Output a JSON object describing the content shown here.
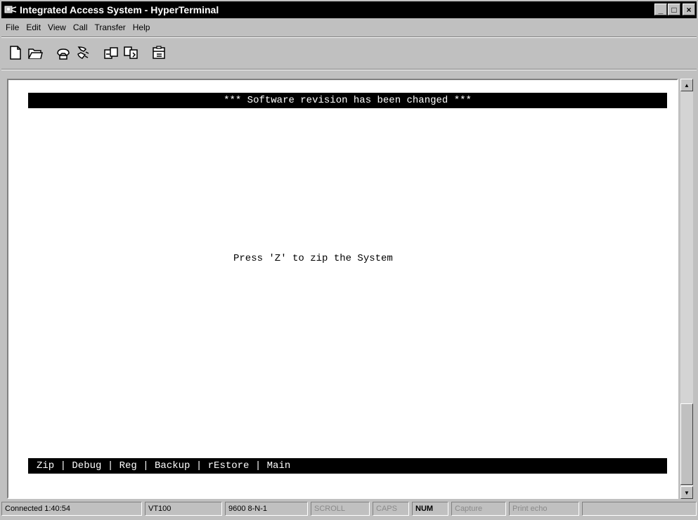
{
  "window": {
    "title": "Integrated Access System - HyperTerminal",
    "controls": {
      "minimize": "_",
      "maximize": "□",
      "close": "×"
    }
  },
  "menu": [
    "File",
    "Edit",
    "View",
    "Call",
    "Transfer",
    "Help"
  ],
  "toolbar": {
    "buttons": [
      "new-icon",
      "open-icon",
      "connect-icon",
      "disconnect-icon",
      "send-icon",
      "receive-icon",
      "properties-icon"
    ]
  },
  "terminal": {
    "header": "*** Software revision has been changed ***",
    "message": "Press 'Z' to zip the System",
    "footer": "Zip | Debug | Reg | Backup | rEstore | Main"
  },
  "statusbar": {
    "connected": "Connected 1:40:54",
    "emulation": "VT100",
    "settings": "9600 8-N-1",
    "scroll": "SCROLL",
    "caps": "CAPS",
    "num": "NUM",
    "capture": "Capture",
    "print_echo": "Print echo"
  }
}
